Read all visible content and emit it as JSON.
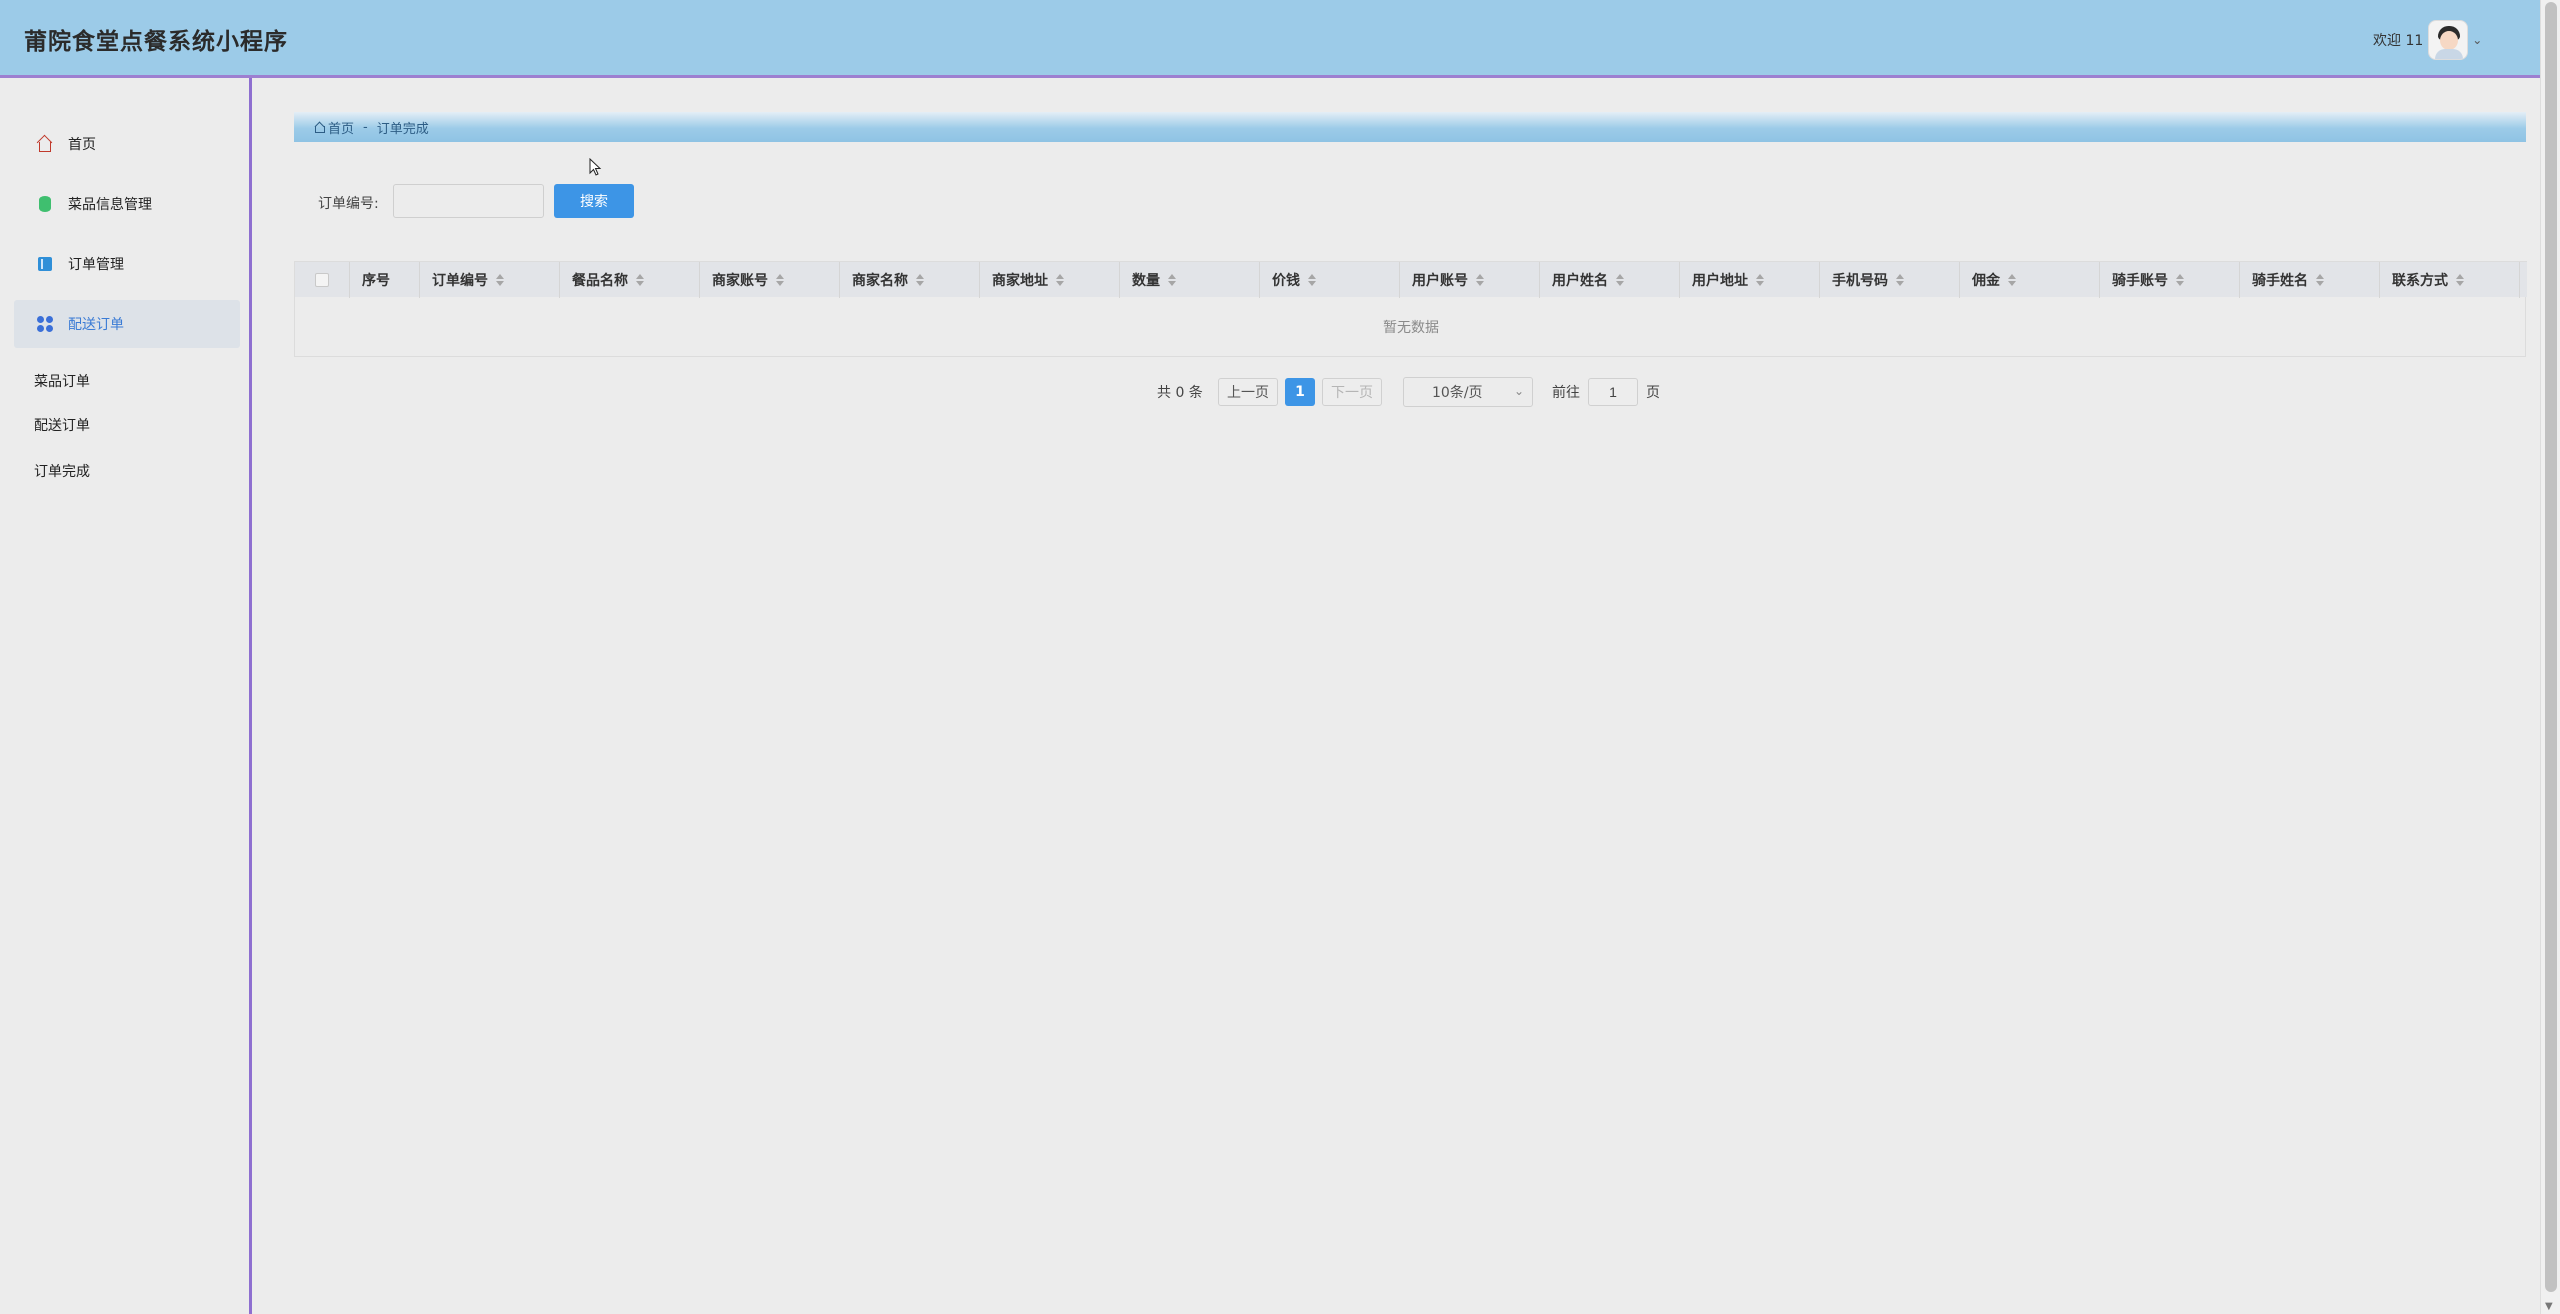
{
  "app": {
    "title": "莆院食堂点餐系统小程序"
  },
  "user": {
    "welcome": "欢迎 11",
    "avatar_icon": "avatar-icon"
  },
  "sidebar": {
    "items": [
      {
        "label": "首页",
        "icon": "home-icon"
      },
      {
        "label": "菜品信息管理",
        "icon": "database-icon"
      },
      {
        "label": "订单管理",
        "icon": "book-icon"
      },
      {
        "label": "配送订单",
        "icon": "grid-icon",
        "active": true
      }
    ],
    "sub_items": [
      "菜品订单",
      "配送订单",
      "订单完成"
    ]
  },
  "breadcrumb": {
    "home": "首页",
    "separator": "-",
    "current": "订单完成"
  },
  "search": {
    "label": "订单编号:",
    "value": "",
    "button": "搜索"
  },
  "table": {
    "columns": [
      "序号",
      "订单编号",
      "餐品名称",
      "商家账号",
      "商家名称",
      "商家地址",
      "数量",
      "价钱",
      "用户账号",
      "用户姓名",
      "用户地址",
      "手机号码",
      "佣金",
      "骑手账号",
      "骑手姓名",
      "联系方式"
    ],
    "sortable": [
      false,
      true,
      true,
      true,
      true,
      true,
      true,
      true,
      true,
      true,
      true,
      true,
      true,
      true,
      true,
      true
    ],
    "rows": [],
    "empty_text": "暂无数据"
  },
  "pagination": {
    "total_text": "共 0 条",
    "prev": "上一页",
    "current_page": "1",
    "next": "下一页",
    "page_size": "10条/页",
    "goto_label": "前往",
    "goto_value": "1",
    "page_suffix": "页"
  },
  "colors": {
    "header_bg": "#9ccbe8",
    "accent_purple": "#8e6fd0",
    "primary_blue": "#3d95e6",
    "background": "#ececec"
  }
}
